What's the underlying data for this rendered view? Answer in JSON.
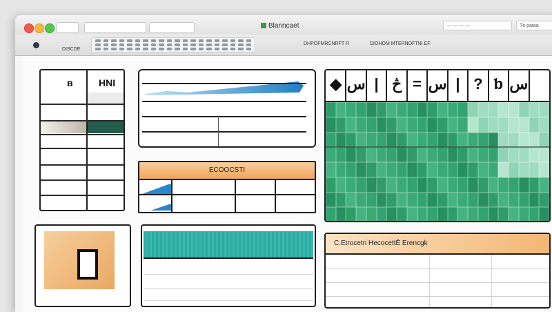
{
  "window": {
    "title": "Blanncaet",
    "search_placeholder": "— — — —",
    "search_placeholder_2": "Té раtаа"
  },
  "toolbar": {
    "left_label": "DISCDE",
    "right_label_1": "DHPOFMRCNRFT R",
    "right_label_2": "DIOHOM MTERNOFTNI EF"
  },
  "left_table": {
    "header_1": "в",
    "header_2": "HNI"
  },
  "grid": {
    "headers": [
      "◆",
      "س",
      "|",
      "څ",
      "=",
      "س",
      "|",
      "?",
      "ƅ",
      "س",
      ""
    ]
  },
  "orange_panel": {
    "title": "ECOOCSTI"
  },
  "bottom_right": {
    "title": "C.Etrocetri HecocettĒ Erencgk"
  },
  "colors": {
    "accent_orange": "#f0a55c",
    "grid_green": "#2e9d6a",
    "teal": "#2fa8a2",
    "chart_blue": "#2b86c8"
  },
  "icons": {
    "document": "document-icon",
    "toolbar_circle": "toolbar-circle-icon"
  }
}
